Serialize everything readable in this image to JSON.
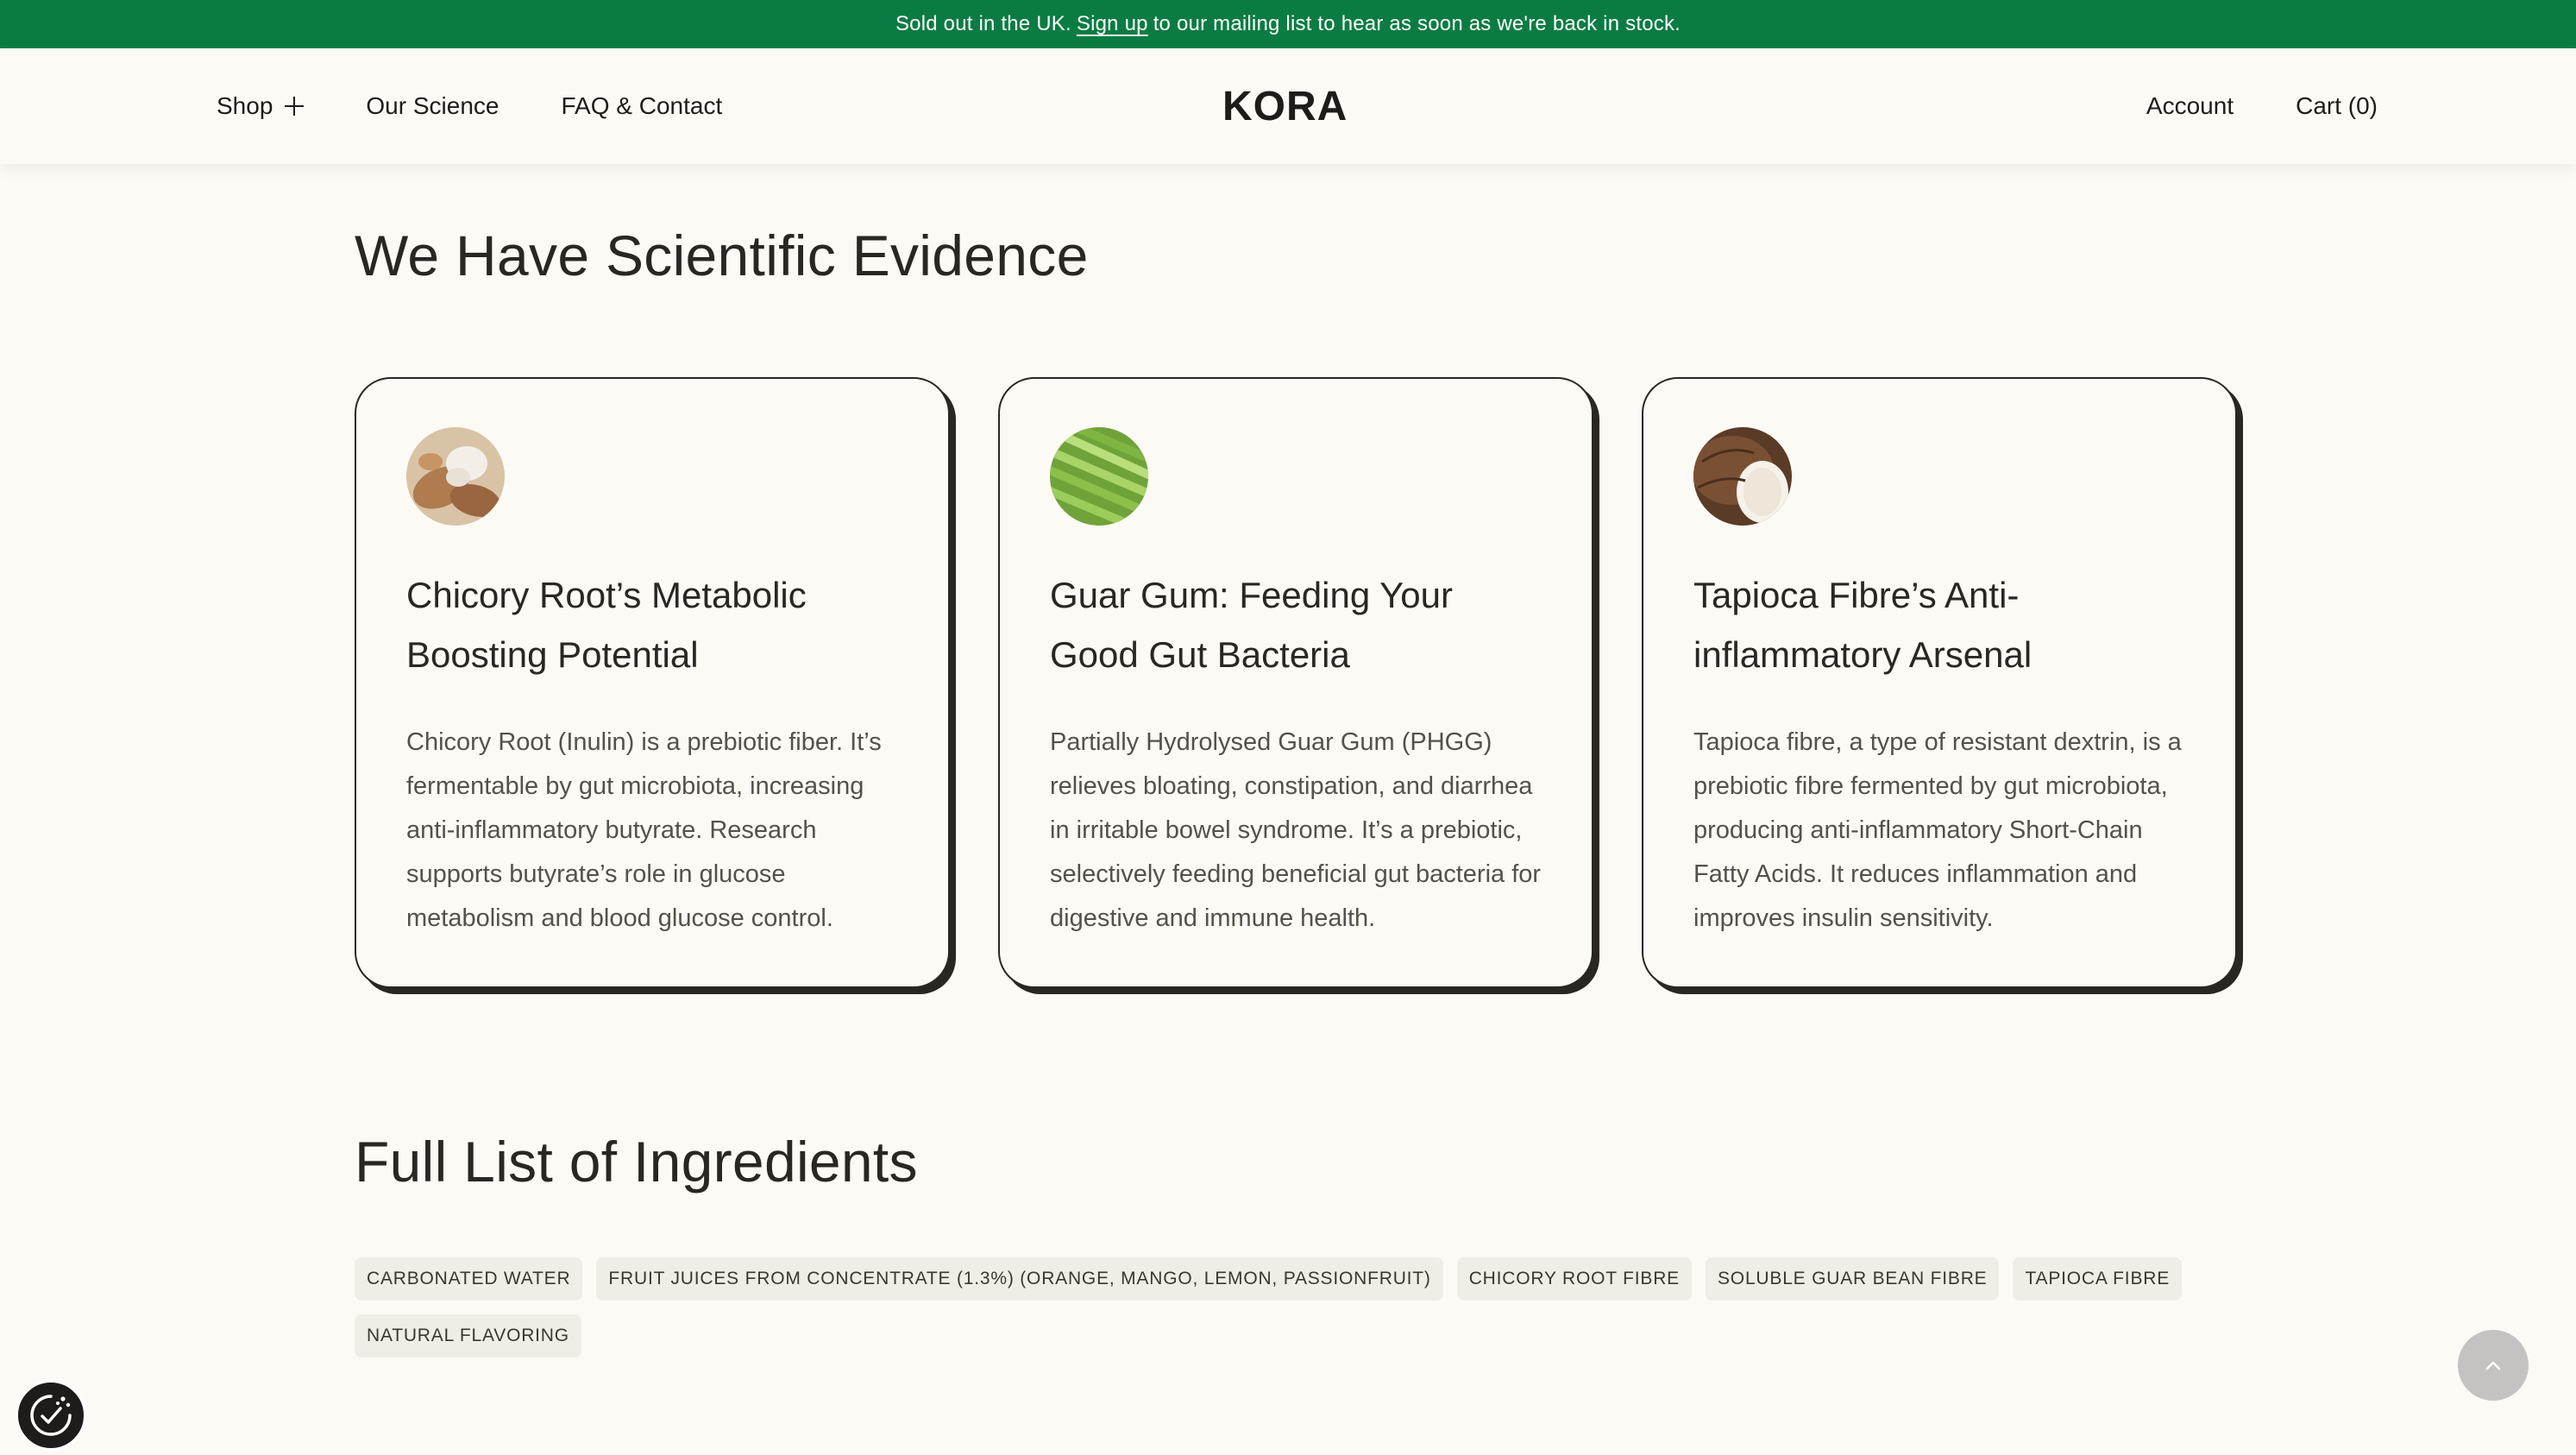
{
  "announcement": {
    "before": "Sold out in the UK.",
    "link": "Sign up",
    "after": "to our mailing list to hear as soon as we're back in stock."
  },
  "nav": {
    "shop": "Shop",
    "science": "Our Science",
    "faq": "FAQ & Contact",
    "logo": "KORA",
    "account": "Account",
    "cart": "Cart (0)"
  },
  "evidence": {
    "title": "We Have Scientific Evidence",
    "cards": [
      {
        "title": "Chicory Root’s Metabolic Boosting Potential",
        "body": "Chicory Root (Inulin) is a prebiotic fiber. It’s fermentable by gut microbiota, increasing anti-inflammatory butyrate. Research supports butyrate’s role in glucose metabolism and blood glucose control.",
        "icon": "chicory-root-image"
      },
      {
        "title": "Guar Gum: Feeding Your Good Gut Bacteria",
        "body": "Partially Hydrolysed Guar Gum (PHGG) relieves bloating, constipation, and diarrhea in irritable bowel syndrome. It’s a prebiotic, selectively feeding beneficial gut bacteria for digestive and immune health.",
        "icon": "guar-beans-image"
      },
      {
        "title": "Tapioca Fibre’s Anti-inflammatory Arsenal",
        "body": "Tapioca fibre, a type of resistant dextrin, is a prebiotic fibre fermented by gut microbiota, producing anti-inflammatory Short-Chain Fatty Acids. It reduces inflammation and improves insulin sensitivity.",
        "icon": "tapioca-root-image"
      }
    ]
  },
  "ingredients": {
    "title": "Full List of Ingredients",
    "items": [
      "CARBONATED WATER",
      "FRUIT JUICES FROM CONCENTRATE (1.3%) (ORANGE, MANGO, LEMON, PASSIONFRUIT)",
      "CHICORY ROOT FIBRE",
      "SOLUBLE GUAR BEAN FIBRE",
      "TAPIOCA FIBRE",
      "NATURAL FLAVORING"
    ]
  },
  "colors": {
    "announcement_bg": "#0a7c43",
    "page_bg": "#fcfaf4",
    "text": "#2a2622",
    "tag_bg": "#efede6"
  }
}
